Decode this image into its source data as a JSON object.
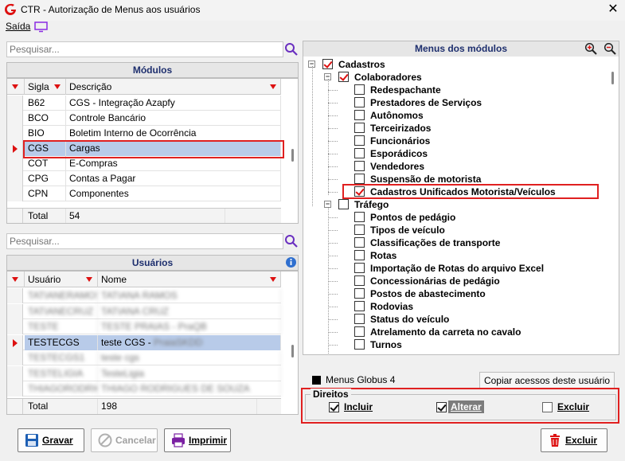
{
  "window": {
    "title": "CTR - Autorização de Menus aos usuários",
    "close_glyph": "✕",
    "app_icon": "globus-logo-icon"
  },
  "menubar": {
    "exit_label": "Saída",
    "screen_icon": "monitor-icon"
  },
  "modules": {
    "search_placeholder": "Pesquisar...",
    "header": "Módulos",
    "col_sigla": "Sigla",
    "col_descricao": "Descrição",
    "rows": [
      {
        "sigla": "B62",
        "descricao": "CGS - Integração Azapfy"
      },
      {
        "sigla": "BCO",
        "descricao": "Controle Bancário"
      },
      {
        "sigla": "BIO",
        "descricao": "Boletim Interno de Ocorrência"
      },
      {
        "sigla": "CGS",
        "descricao": "Cargas"
      },
      {
        "sigla": "COT",
        "descricao": "E-Compras"
      },
      {
        "sigla": "CPG",
        "descricao": "Contas a Pagar"
      },
      {
        "sigla": "CPN",
        "descricao": "Componentes"
      }
    ],
    "selected_index": 3,
    "total_label": "Total",
    "total_value": "54"
  },
  "users": {
    "search_placeholder": "Pesquisar...",
    "header": "Usuários",
    "col_usuario": "Usuário",
    "col_nome": "Nome",
    "rows": [
      {
        "usuario": "TATIANERAMOS",
        "nome": "TATIANA RAMOS"
      },
      {
        "usuario": "TATIANECRUZ",
        "nome": "TATIANA CRUZ"
      },
      {
        "usuario": "TESTE",
        "nome": "TESTE PRAIAS - PraQB"
      },
      {
        "usuario": "TESTECGS",
        "nome": "teste CGS - PraiaSKDD"
      },
      {
        "usuario": "TESTECGS1",
        "nome": "teste cgs"
      },
      {
        "usuario": "TESTELIGIA",
        "nome": "TesteLigia"
      },
      {
        "usuario": "THIAGORODRIGUES",
        "nome": "THIAGO RODRIGUES DE SOUZA"
      }
    ],
    "selected_index": 3,
    "total_label": "Total",
    "total_value": "198"
  },
  "menus": {
    "header": "Menus dos módulos",
    "tree": [
      {
        "level": 0,
        "label": "Cadastros",
        "expander": "−",
        "checked": true
      },
      {
        "level": 1,
        "label": "Colaboradores",
        "expander": "−",
        "checked": true
      },
      {
        "level": 2,
        "label": "Redespachante",
        "checked": false
      },
      {
        "level": 2,
        "label": "Prestadores de Serviços",
        "checked": false
      },
      {
        "level": 2,
        "label": "Autônomos",
        "checked": false
      },
      {
        "level": 2,
        "label": "Terceirizados",
        "checked": false
      },
      {
        "level": 2,
        "label": "Funcionários",
        "checked": false
      },
      {
        "level": 2,
        "label": "Esporádicos",
        "checked": false
      },
      {
        "level": 2,
        "label": "Vendedores",
        "checked": false
      },
      {
        "level": 2,
        "label": "Suspensão de motorista",
        "checked": false
      },
      {
        "level": 2,
        "label": "Cadastros Unificados Motorista/Veículos",
        "checked": true
      },
      {
        "level": 1,
        "label": "Tráfego",
        "expander": "−",
        "checked": false
      },
      {
        "level": 2,
        "label": "Pontos de pedágio",
        "checked": false
      },
      {
        "level": 2,
        "label": "Tipos de veículo",
        "checked": false
      },
      {
        "level": 2,
        "label": "Classificações de transporte",
        "checked": false
      },
      {
        "level": 2,
        "label": "Rotas",
        "checked": false
      },
      {
        "level": 2,
        "label": "Importação de Rotas do arquivo Excel",
        "checked": false
      },
      {
        "level": 2,
        "label": "Concessionárias de pedágio",
        "checked": false
      },
      {
        "level": 2,
        "label": "Postos de abastecimento",
        "checked": false
      },
      {
        "level": 2,
        "label": "Rodovias",
        "checked": false
      },
      {
        "level": 2,
        "label": "Status do veículo",
        "checked": false
      },
      {
        "level": 2,
        "label": "Atrelamento da carreta no cavalo",
        "checked": false
      },
      {
        "level": 2,
        "label": "Turnos",
        "checked": false
      }
    ],
    "legend_label": "Menus Globus 4",
    "copy_button": "Copiar acessos deste usuário"
  },
  "rights": {
    "title": "Direitos",
    "incluir": {
      "label": "Incluir",
      "checked": true
    },
    "alterar": {
      "label": "Alterar",
      "checked": true
    },
    "excluir": {
      "label": "Excluir",
      "checked": false
    }
  },
  "buttons": {
    "gravar": "Gravar",
    "cancelar": "Cancelar",
    "imprimir": "Imprimir",
    "excluir": "Excluir"
  },
  "colors": {
    "accent_red": "#e02020",
    "header_text": "#1e2f6e",
    "selection": "#b8cbe9",
    "search_icon": "#6a2fc0"
  }
}
